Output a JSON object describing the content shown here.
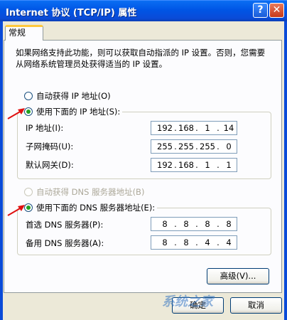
{
  "window": {
    "title": "Internet 协议 (TCP/IP) 属性",
    "help_glyph": "?",
    "close_glyph": "✕"
  },
  "tab": {
    "label": "常规"
  },
  "description": "如果网络支持此功能，则可以获取自动指派的 IP 设置。否则，您需要从网络系统管理员处获得适当的 IP 设置。",
  "ip": {
    "auto_label": "自动获得 IP 地址(O)",
    "manual_label": "使用下面的 IP 地址(S):",
    "selected": "manual",
    "fields": [
      {
        "label": "IP 地址(I):",
        "octets": [
          "192",
          "168",
          "1",
          "14"
        ]
      },
      {
        "label": "子网掩码(U):",
        "octets": [
          "255",
          "255",
          "255",
          "0"
        ]
      },
      {
        "label": "默认网关(D):",
        "octets": [
          "192",
          "168",
          "1",
          "1"
        ]
      }
    ]
  },
  "dns": {
    "auto_label": "自动获得 DNS 服务器地址(B)",
    "manual_label": "使用下面的 DNS 服务器地址(E):",
    "selected": "manual",
    "fields": [
      {
        "label": "首选 DNS 服务器(P):",
        "octets": [
          "8",
          "8",
          "8",
          "8"
        ]
      },
      {
        "label": "备用 DNS 服务器(A):",
        "octets": [
          "8",
          "8",
          "4",
          "4"
        ]
      }
    ]
  },
  "buttons": {
    "advanced": "高级(V)...",
    "ok": "确定",
    "cancel": "取消"
  },
  "watermark": "系统之家",
  "colors": {
    "title_bar": "#0055e5",
    "dialog_bg": "#ece9d8",
    "tab_accent": "#ffc83c",
    "arrow": "#e01010",
    "radio_dot": "#21a121"
  }
}
